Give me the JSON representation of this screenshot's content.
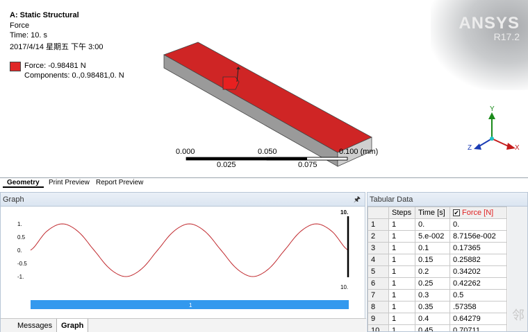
{
  "viewport": {
    "title": "A: Static Structural",
    "subtitle": "Force",
    "time": "Time: 10. s",
    "date": "2017/4/14 星期五 下午 3:00",
    "legend_force": "Force: -0.98481 N",
    "legend_components": "Components: 0.,0.98481,0. N",
    "legend_color": "#e02828",
    "brand": "ANSYS",
    "version": "R17.2",
    "scale": {
      "top_labels": [
        "0.000",
        "0.050",
        "0.100 (mm)"
      ],
      "bottom_labels": [
        "0.025",
        "0.075"
      ]
    },
    "triad": {
      "x": "X",
      "y": "Y",
      "z": "Z"
    }
  },
  "geo_tabs": {
    "geometry": "Geometry",
    "print_preview": "Print Preview",
    "report_preview": "Report Preview"
  },
  "graph": {
    "header": "Graph",
    "pin_icon": "pin-icon",
    "y_ticks": [
      "1.",
      "0.5",
      "0.",
      "-0.5",
      "-1."
    ],
    "x_end_label": "10.",
    "x_end_label_bottom": "10.",
    "timeline_label": "1",
    "curve_color": "#c0282d",
    "bar_color": "#3399ee"
  },
  "bottom_tabs": {
    "messages": "Messages",
    "graph": "Graph"
  },
  "tabular": {
    "header": "Tabular Data",
    "columns": [
      "Steps",
      "Time [s]",
      "Force [N]"
    ],
    "rows": [
      [
        "1",
        "1",
        "0.",
        "0."
      ],
      [
        "2",
        "1",
        "5.e-002",
        "8.7156e-002"
      ],
      [
        "3",
        "1",
        "0.1",
        "0.17365"
      ],
      [
        "4",
        "1",
        "0.15",
        "0.25882"
      ],
      [
        "5",
        "1",
        "0.2",
        "0.34202"
      ],
      [
        "6",
        "1",
        "0.25",
        "0.42262"
      ],
      [
        "7",
        "1",
        "0.3",
        "0.5"
      ],
      [
        "8",
        "1",
        "0.35",
        ".57358"
      ],
      [
        "9",
        "1",
        "0.4",
        "0.64279"
      ],
      [
        "10",
        "1",
        "0.45",
        "0.70711"
      ]
    ]
  },
  "chart_data": {
    "type": "line",
    "x": [
      0,
      0.5,
      1,
      1.5,
      2,
      2.5,
      3,
      3.5,
      4,
      4.5,
      5,
      5.5,
      6,
      6.5,
      7,
      7.5,
      8,
      8.5,
      9,
      9.5,
      10
    ],
    "series": [
      {
        "values": [
          0,
          0.707,
          1,
          0.707,
          0,
          -0.707,
          -1,
          -0.707,
          0,
          0.707,
          1,
          0.707,
          0,
          -0.707,
          -1,
          -0.707,
          0,
          0.707,
          1,
          0.707,
          0
        ]
      }
    ],
    "ylim": [
      -1,
      1
    ],
    "xlim": [
      0,
      10
    ]
  }
}
